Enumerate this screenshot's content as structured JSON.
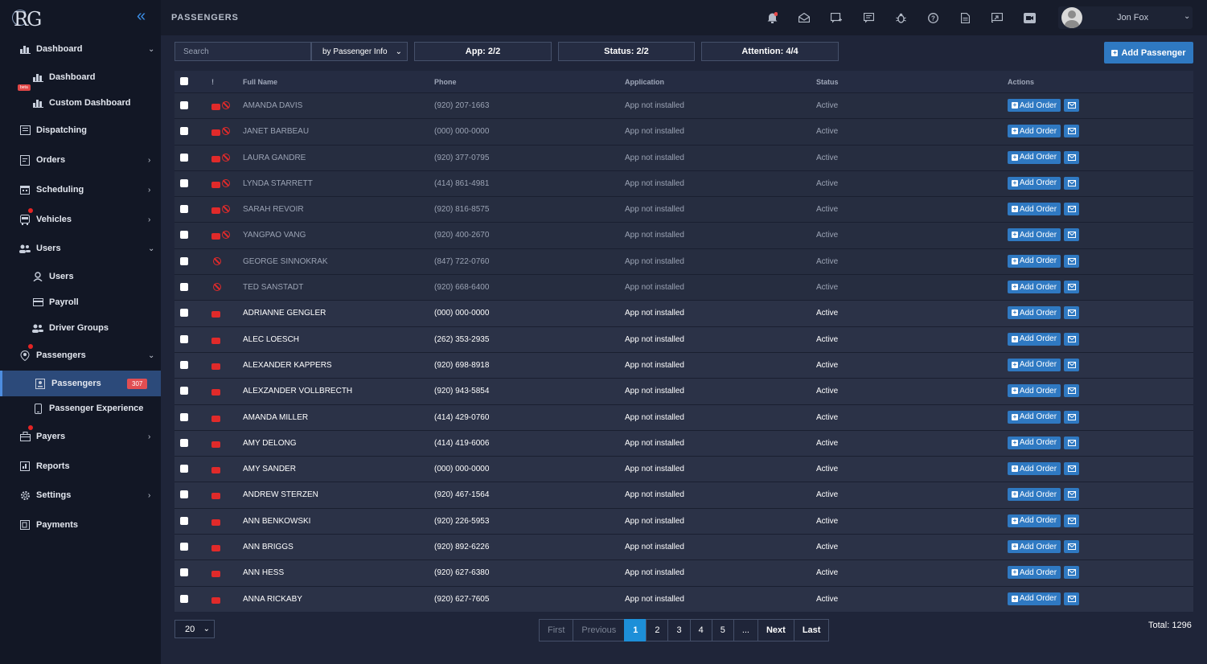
{
  "app": {
    "logo": "RG",
    "title": "PASSENGERS"
  },
  "sidebar": {
    "items": [
      {
        "label": "Dashboard",
        "icon": "chart-bar-icon",
        "chevron": "⌄"
      },
      {
        "label": "Dashboard",
        "icon": "chart-bar-icon"
      },
      {
        "label": "Custom Dashboard",
        "icon": "chart-bar-icon",
        "badge": "beta"
      },
      {
        "label": "Dispatching",
        "icon": "list-window-icon"
      },
      {
        "label": "Orders",
        "icon": "order-doc-icon",
        "chevron": "›"
      },
      {
        "label": "Scheduling",
        "icon": "calendar-icon",
        "chevron": "›"
      },
      {
        "label": "Vehicles",
        "icon": "bus-icon",
        "chevron": "›"
      },
      {
        "label": "Users",
        "icon": "users-icon",
        "chevron": "⌄"
      },
      {
        "label": "Users",
        "icon": "user-icon"
      },
      {
        "label": "Payroll",
        "icon": "card-icon"
      },
      {
        "label": "Driver Groups",
        "icon": "group-icon"
      },
      {
        "label": "Passengers",
        "icon": "location-person-icon",
        "chevron": "⌄"
      },
      {
        "label": "Passengers",
        "icon": "id-card-icon",
        "count": "307"
      },
      {
        "label": "Passenger Experience",
        "icon": "phone-icon"
      },
      {
        "label": "Payers",
        "icon": "briefcase-icon",
        "chevron": "›"
      },
      {
        "label": "Reports",
        "icon": "report-icon"
      },
      {
        "label": "Settings",
        "icon": "gear-icon",
        "chevron": "›"
      },
      {
        "label": "Payments",
        "icon": "payment-icon"
      }
    ]
  },
  "user": {
    "name": "Jon Fox"
  },
  "filters": {
    "search_placeholder": "Search",
    "by": "by Passenger Info",
    "app": "App: 2/2",
    "status": "Status: 2/2",
    "attention": "Attention: 4/4"
  },
  "add_passenger_label": "Add Passenger",
  "table": {
    "headers": {
      "attention": "!",
      "name": "Full Name",
      "phone": "Phone",
      "application": "Application",
      "status": "Status",
      "actions": "Actions"
    },
    "add_order_label": "Add Order",
    "rows": [
      {
        "name": "AMANDA DAVIS",
        "phone": "(920) 207-1663",
        "app": "App not installed",
        "status": "Active",
        "style": "grey",
        "flags": "car-ban"
      },
      {
        "name": "JANET BARBEAU",
        "phone": "(000) 000-0000",
        "app": "App not installed",
        "status": "Active",
        "style": "grey",
        "flags": "car-ban"
      },
      {
        "name": "LAURA GANDRE",
        "phone": "(920) 377-0795",
        "app": "App not installed",
        "status": "Active",
        "style": "grey",
        "flags": "car-ban"
      },
      {
        "name": "LYNDA STARRETT",
        "phone": "(414) 861-4981",
        "app": "App not installed",
        "status": "Active",
        "style": "grey",
        "flags": "car-ban"
      },
      {
        "name": "SARAH REVOIR",
        "phone": "(920) 816-8575",
        "app": "App not installed",
        "status": "Active",
        "style": "grey",
        "flags": "car-ban"
      },
      {
        "name": "YANGPAO VANG",
        "phone": "(920) 400-2670",
        "app": "App not installed",
        "status": "Active",
        "style": "grey",
        "flags": "car-ban"
      },
      {
        "name": "GEORGE SINNOKRAK",
        "phone": "(847) 722-0760",
        "app": "App not installed",
        "status": "Active",
        "style": "grey",
        "flags": "ban"
      },
      {
        "name": "TED SANSTADT",
        "phone": "(920) 668-6400",
        "app": "App not installed",
        "status": "Active",
        "style": "grey",
        "flags": "ban"
      },
      {
        "name": "ADRIANNE GENGLER",
        "phone": "(000) 000-0000",
        "app": "App not installed",
        "status": "Active",
        "style": "norm",
        "flags": "car"
      },
      {
        "name": "ALEC LOESCH",
        "phone": "(262) 353-2935",
        "app": "App not installed",
        "status": "Active",
        "style": "norm",
        "flags": "car"
      },
      {
        "name": "ALEXANDER KAPPERS",
        "phone": "(920) 698-8918",
        "app": "App not installed",
        "status": "Active",
        "style": "norm",
        "flags": "car"
      },
      {
        "name": "ALEXZANDER VOLLBRECTH",
        "phone": "(920) 943-5854",
        "app": "App not installed",
        "status": "Active",
        "style": "norm",
        "flags": "car"
      },
      {
        "name": "AMANDA MILLER",
        "phone": "(414) 429-0760",
        "app": "App not installed",
        "status": "Active",
        "style": "norm",
        "flags": "car"
      },
      {
        "name": "AMY DELONG",
        "phone": "(414) 419-6006",
        "app": "App not installed",
        "status": "Active",
        "style": "norm",
        "flags": "car"
      },
      {
        "name": "AMY SANDER",
        "phone": "(000) 000-0000",
        "app": "App not installed",
        "status": "Active",
        "style": "norm",
        "flags": "car"
      },
      {
        "name": "ANDREW STERZEN",
        "phone": "(920) 467-1564",
        "app": "App not installed",
        "status": "Active",
        "style": "norm",
        "flags": "car"
      },
      {
        "name": "ANN BENKOWSKI",
        "phone": "(920) 226-5953",
        "app": "App not installed",
        "status": "Active",
        "style": "norm",
        "flags": "car"
      },
      {
        "name": "ANN BRIGGS",
        "phone": "(920) 892-6226",
        "app": "App not installed",
        "status": "Active",
        "style": "norm",
        "flags": "car"
      },
      {
        "name": "ANN HESS",
        "phone": "(920) 627-6380",
        "app": "App not installed",
        "status": "Active",
        "style": "norm",
        "flags": "car"
      },
      {
        "name": "ANNA RICKABY",
        "phone": "(920) 627-7605",
        "app": "App not installed",
        "status": "Active",
        "style": "norm",
        "flags": "car"
      }
    ]
  },
  "footer": {
    "page_size": "20",
    "pages": [
      "First",
      "Previous",
      "1",
      "2",
      "3",
      "4",
      "5",
      "...",
      "Next",
      "Last"
    ],
    "current_page": "1",
    "total": "Total: 1296"
  },
  "colors": {
    "accent": "#2f79c2",
    "sidebar_active": "#2c4a7a",
    "alert": "#e02a2a",
    "current_page": "#1d8fd8"
  }
}
